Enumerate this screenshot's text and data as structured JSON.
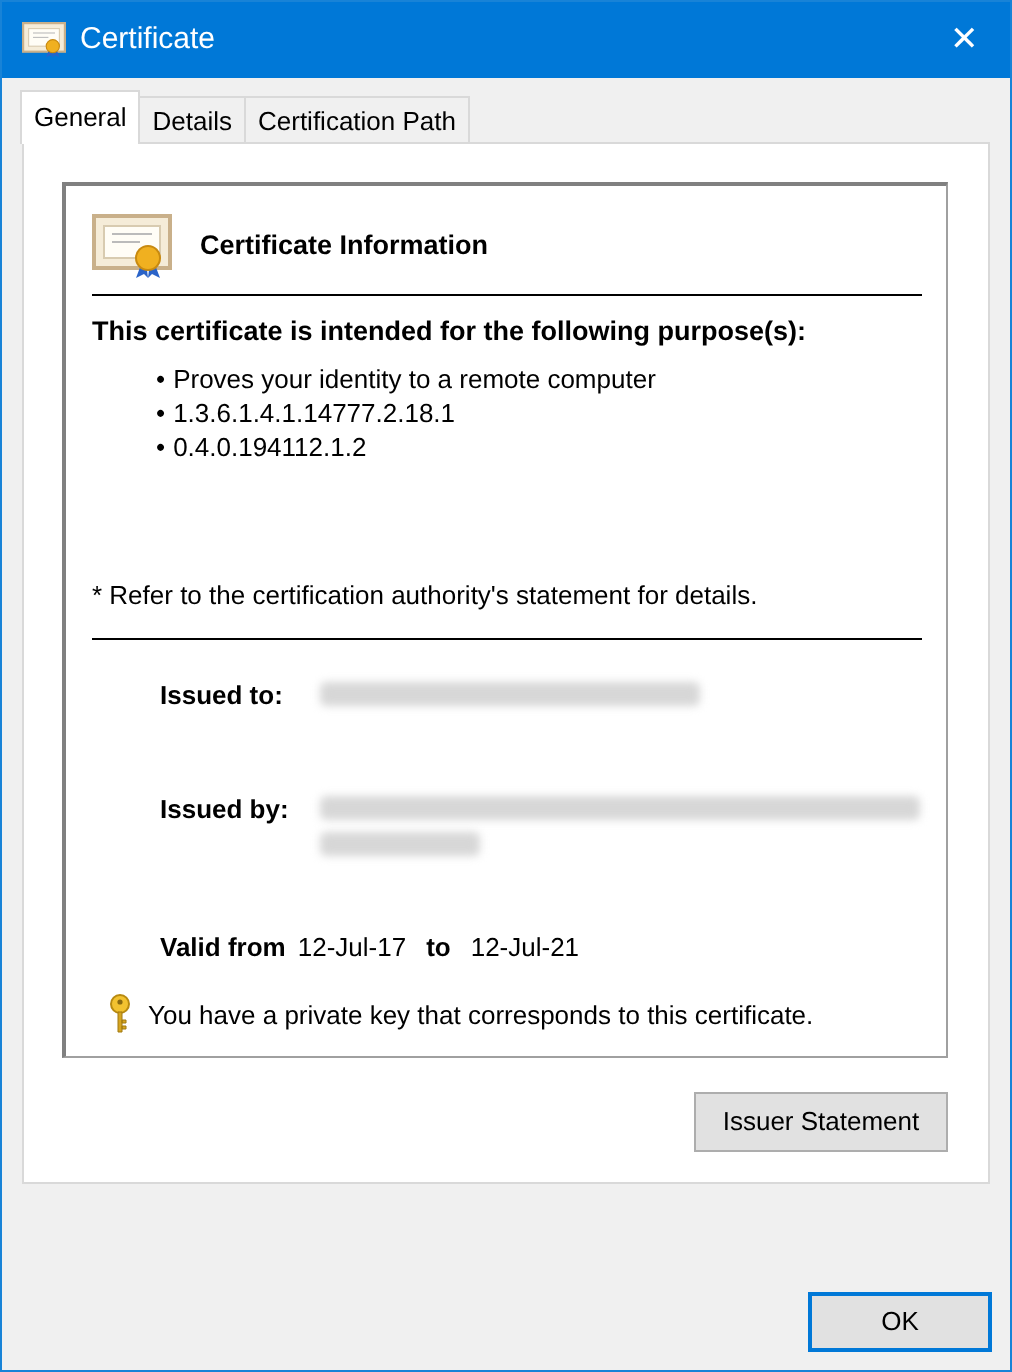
{
  "window": {
    "title": "Certificate",
    "close": "✕"
  },
  "tabs": [
    {
      "label": "General",
      "selected": true
    },
    {
      "label": "Details",
      "selected": false
    },
    {
      "label": "Certification Path",
      "selected": false
    }
  ],
  "info": {
    "heading": "Certificate Information",
    "purpose_title": "This certificate is intended for the following purpose(s):",
    "bullet": "•",
    "purposes": [
      "Proves your identity to a remote computer",
      "1.3.6.1.4.1.14777.2.18.1",
      "0.4.0.194112.1.2"
    ],
    "note": "* Refer to the certification authority's statement for details.",
    "issued_to": {
      "label": "Issued to:",
      "lines": [
        {
          "kind": "blurred"
        }
      ]
    },
    "issued_by": {
      "label": "Issued by:",
      "lines": [
        {
          "kind": "blurred"
        },
        {
          "kind": "blurred"
        }
      ]
    },
    "valid_label": "Valid from",
    "valid_from": "12-Jul-17",
    "to_label": "to",
    "valid_to": "12-Jul-21",
    "private_key": "You have a private key that corresponds to this certificate."
  },
  "issuer_button": "Issuer Statement",
  "buttons": [
    "OK"
  ]
}
